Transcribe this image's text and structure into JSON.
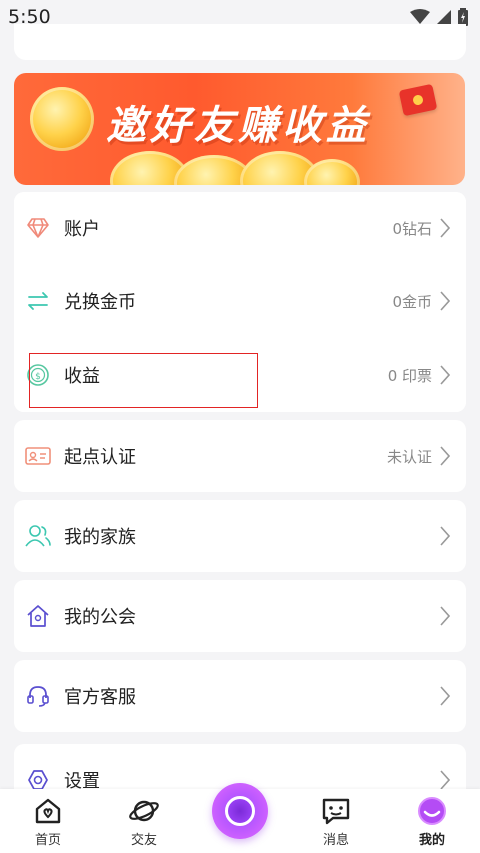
{
  "status_bar": {
    "time": "5:50"
  },
  "banner": {
    "text": "邀好友赚收益"
  },
  "menu": [
    {
      "id": "account",
      "label": "账户",
      "value": "0钻石",
      "icon": "diamond-icon"
    },
    {
      "id": "exchange",
      "label": "兑换金币",
      "value": "0金币",
      "icon": "exchange-arrows-icon"
    },
    {
      "id": "earnings",
      "label": "收益",
      "value": "0 印票",
      "icon": "coin-icon"
    },
    {
      "id": "verify",
      "label": "起点认证",
      "value": "未认证",
      "icon": "id-card-icon"
    },
    {
      "id": "family",
      "label": "我的家族",
      "value": "",
      "icon": "people-icon"
    },
    {
      "id": "guild",
      "label": "我的公会",
      "value": "",
      "icon": "house-icon"
    },
    {
      "id": "support",
      "label": "官方客服",
      "value": "",
      "icon": "headset-icon"
    },
    {
      "id": "settings",
      "label": "设置",
      "value": "",
      "icon": "gear-icon"
    }
  ],
  "tabs": [
    {
      "label": "首页",
      "icon": "home-icon"
    },
    {
      "label": "交友",
      "icon": "planet-icon"
    },
    {
      "label": "消息",
      "icon": "chat-icon"
    },
    {
      "label": "我的",
      "icon": "profile-face-icon",
      "active": true
    }
  ],
  "colors": {
    "accent_purple": "#a448ff",
    "banner_orange": "#ff5a2e",
    "highlight_red": "#e22424"
  }
}
